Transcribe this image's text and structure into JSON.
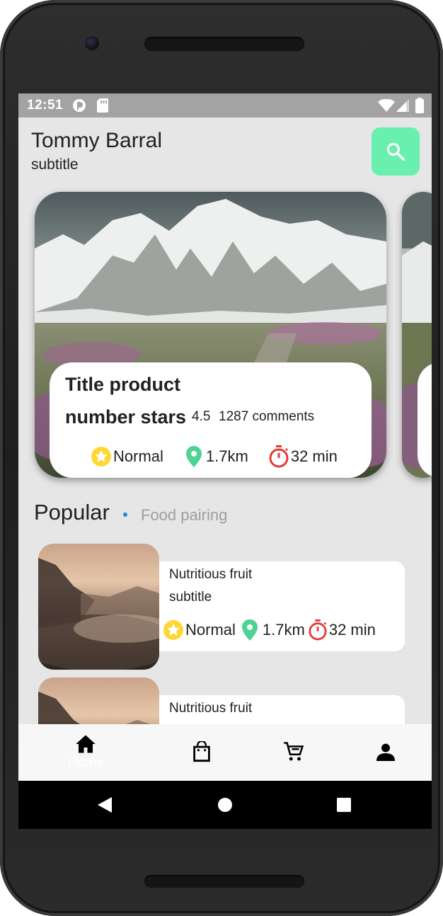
{
  "status_bar": {
    "time": "12:51"
  },
  "header": {
    "name": "Tommy Barral",
    "subtitle": "subtitle"
  },
  "featured": {
    "title": "Title product",
    "stars_label": "number stars",
    "rating": "4.5",
    "comments": "1287 comments",
    "difficulty": "Normal",
    "distance": "1.7km",
    "duration": "32 min"
  },
  "section": {
    "title": "Popular",
    "tab": "Food pairing"
  },
  "list": [
    {
      "title": "Nutritious fruit",
      "subtitle": "subtitle",
      "difficulty": "Normal",
      "distance": "1.7km",
      "duration": "32 min"
    },
    {
      "title": "Nutritious fruit"
    }
  ],
  "bottom_nav": {
    "home_label": "Home"
  },
  "colors": {
    "accent": "#69f0ae",
    "star": "#fdd835",
    "pin": "#4ed394",
    "timer": "#e53935",
    "dot": "#1e88e5"
  }
}
